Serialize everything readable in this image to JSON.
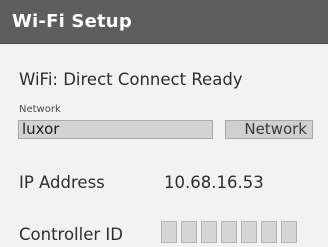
{
  "window": {
    "title": "Wi-Fi Setup"
  },
  "status": {
    "text": "WiFi: Direct Connect Ready"
  },
  "network": {
    "caption": "Network",
    "value": "luxor",
    "button_label": "Network"
  },
  "ip_address": {
    "label": "IP Address",
    "value": "10.68.16.53"
  },
  "controller_id": {
    "label": "Controller ID",
    "digits": [
      "",
      "",
      "",
      "",
      "",
      "",
      ""
    ]
  },
  "colors": {
    "titlebar": "#5e5e5e",
    "background": "#f2f2f2",
    "field": "#d3d3d3"
  }
}
